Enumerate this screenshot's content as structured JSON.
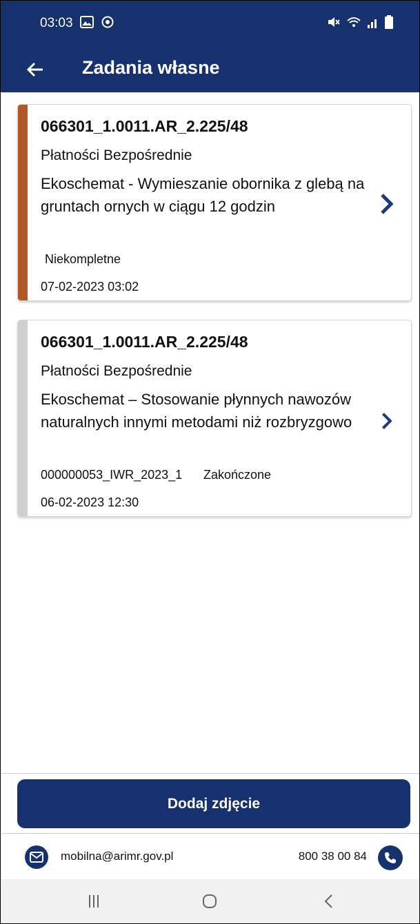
{
  "statusbar": {
    "time": "03:03"
  },
  "appbar": {
    "title": "Zadania własne",
    "back_icon": "arrow-left-icon"
  },
  "tasks": [
    {
      "code": "066301_1.0011.AR_2.225/48",
      "category": "Płatności Bezpośrednie",
      "description": "Ekoschemat - Wymieszanie obornika z glebą na gruntach ornych w ciągu 12 godzin",
      "id": "",
      "status": "Niekompletne",
      "date": "07-02-2023 03:02",
      "accent_color": "#b0572a"
    },
    {
      "code": "066301_1.0011.AR_2.225/48",
      "category": "Płatności Bezpośrednie",
      "description": "Ekoschemat – Stosowanie płynnych nawozów naturalnych innymi metodami niż rozbryzgowo",
      "id": "000000053_IWR_2023_1",
      "status": "Zakończone",
      "date": "06-02-2023 12:30",
      "accent_color": "#cfcfcf"
    }
  ],
  "actions": {
    "add_photo_label": "Dodaj zdjęcie"
  },
  "footer": {
    "email": "mobilna@arimr.gov.pl",
    "phone": "800 38 00 84",
    "email_icon": "mail-icon",
    "phone_icon": "phone-icon"
  },
  "colors": {
    "primary": "#17316e",
    "chevron": "#1c3a7a"
  }
}
